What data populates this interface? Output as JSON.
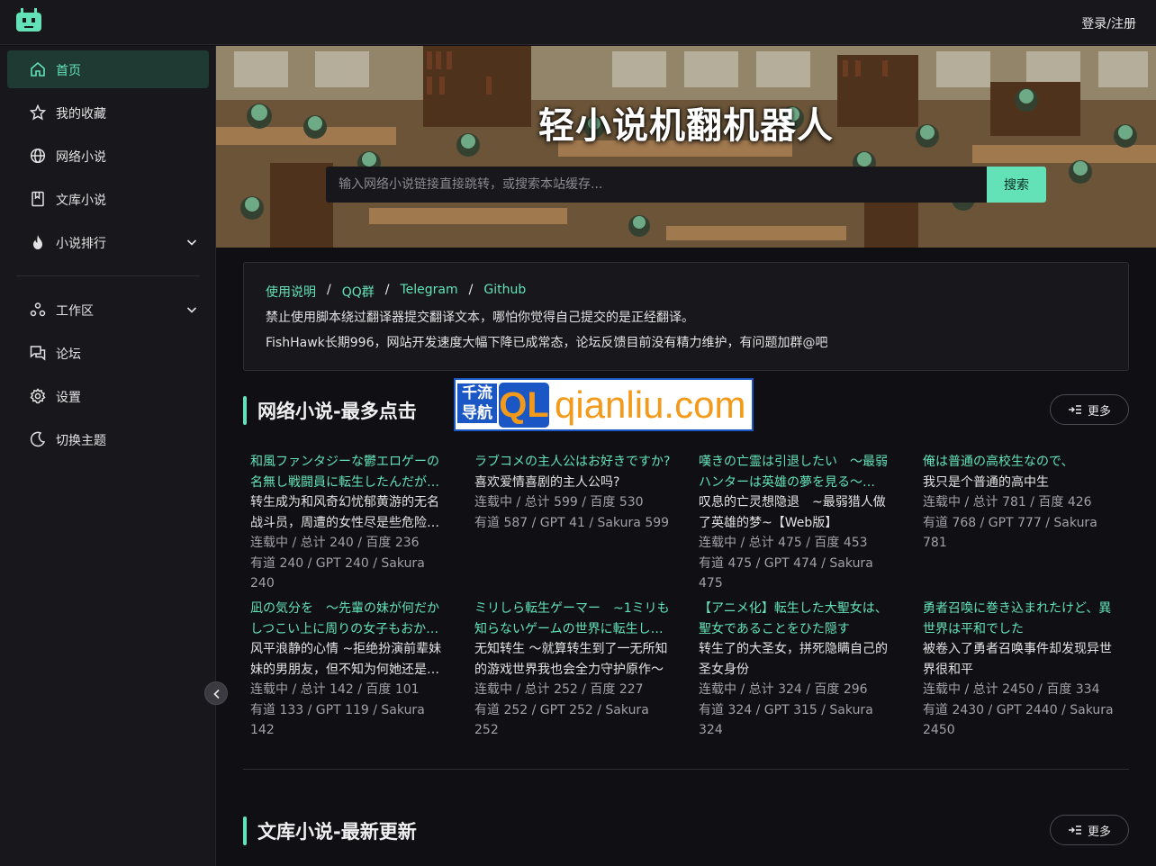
{
  "topbar": {
    "login_label": "登录/注册"
  },
  "sidebar": {
    "items": [
      {
        "label": "首页",
        "icon": "home-icon"
      },
      {
        "label": "我的收藏",
        "icon": "star-icon"
      },
      {
        "label": "网络小说",
        "icon": "globe-icon"
      },
      {
        "label": "文库小说",
        "icon": "book-icon"
      },
      {
        "label": "小说排行",
        "icon": "flame-icon"
      },
      {
        "label": "工作区",
        "icon": "workspace-icon"
      },
      {
        "label": "论坛",
        "icon": "forum-icon"
      },
      {
        "label": "设置",
        "icon": "gear-icon"
      },
      {
        "label": "切换主题",
        "icon": "moon-icon"
      }
    ]
  },
  "hero": {
    "title": "轻小说机翻机器人",
    "search_placeholder": "输入网络小说链接直接跳转，或搜索本站缓存...",
    "search_label": "搜索"
  },
  "notice": {
    "links": [
      "使用说明",
      "QQ群",
      "Telegram",
      "Github"
    ],
    "sep": "/",
    "line1": "禁止使用脚本绕过翻译器提交翻译文本，哪怕你觉得自己提交的是正经翻译。",
    "line2": "FishHawk长期996，网站开发速度大幅下降已成常态，论坛反馈目前没有精力维护，有问题加群@吧"
  },
  "watermark": {
    "cn": "千流导航",
    "ql": "QL",
    "domain": "qianliu.com"
  },
  "sections": [
    {
      "title": "网络小说-最多点击",
      "more_label": "更多"
    },
    {
      "title": "文库小说-最新更新",
      "more_label": "更多"
    }
  ],
  "web_novels": [
    {
      "title": "和風ファンタジーな鬱エロゲーの名無し戦闘員に転生したんだが…",
      "zh": "转生成为和风奇幻忧郁黄游的无名战斗员，周遭的女性尽是些危险…",
      "status": "连载中 / 总计 240 / 百度 236",
      "stats": "有道 240 / GPT 240 / Sakura 240"
    },
    {
      "title": "ラブコメの主人公はお好きですか?",
      "zh": "喜欢爱情喜剧的主人公吗?",
      "status": "连载中 / 总计 599 / 百度 530",
      "stats": "有道 587 / GPT 41 / Sakura 599"
    },
    {
      "title": "嘆きの亡霊は引退したい　～最弱ハンターは英雄の夢を見る～…",
      "zh": "叹息的亡灵想隐退　~最弱猎人做了英雄的梦~【Web版】",
      "status": "连载中 / 总计 475 / 百度 453",
      "stats": "有道 475 / GPT 474 / Sakura 475"
    },
    {
      "title": "俺は普通の高校生なので、",
      "zh": "我只是个普通的高中生",
      "status": "连载中 / 总计 781 / 百度 426",
      "stats": "有道 768 / GPT 777 / Sakura 781"
    },
    {
      "title": "凪の気分を　～先輩の妹が何だかしつこい上に周りの女子もおか…",
      "zh": "风平浪静的心情 ~拒绝扮演前辈妹妹的男朋友，但不知为何她还是…",
      "status": "连载中 / 总计 142 / 百度 101",
      "stats": "有道 133 / GPT 119 / Sakura 142"
    },
    {
      "title": "ミリしら転生ゲーマー　~1ミリも知らないゲームの世界に転生し…",
      "zh": "无知转生 ～就算转生到了一无所知的游戏世界我也会全力守护原作～",
      "status": "连载中 / 总计 252 / 百度 227",
      "stats": "有道 252 / GPT 252 / Sakura 252"
    },
    {
      "title": "【アニメ化】転生した大聖女は、聖女であることをひた隠す",
      "zh": "转生了的大圣女，拼死隐瞒自己的圣女身份",
      "status": "连载中 / 总计 324 / 百度 296",
      "stats": "有道 324 / GPT 315 / Sakura 324"
    },
    {
      "title": "勇者召喚に巻き込まれたけど、異世界は平和でした",
      "zh": "被卷入了勇者召唤事件却发现异世界很和平",
      "status": "连载中 / 总计 2450 / 百度 334",
      "stats": "有道 2430 / GPT 2440 / Sakura 2450"
    }
  ],
  "colors": {
    "accent": "#63e2b7",
    "bg": "#101014",
    "panel": "#18181c"
  }
}
